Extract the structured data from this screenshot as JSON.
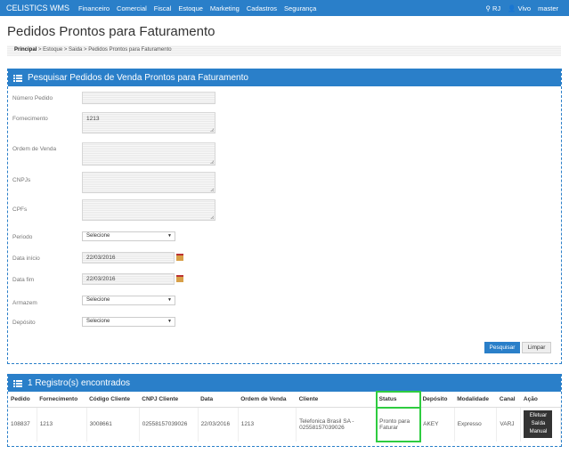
{
  "navbar": {
    "brand": "CELISTICS WMS",
    "menu": [
      "Financeiro",
      "Comercial",
      "Fiscal",
      "Estoque",
      "Marketing",
      "Cadastros",
      "Segurança"
    ],
    "location": "RJ",
    "user_name": "Vivo",
    "user_role": "master"
  },
  "page": {
    "title": "Pedidos Prontos para Faturamento",
    "breadcrumb_root": "Principal",
    "breadcrumb_rest": " > Estoque > Saida > Pedidos Prontos para Faturamento"
  },
  "search_panel": {
    "title": "Pesquisar Pedidos de Venda Prontos para Faturamento",
    "fields": {
      "numero_pedido": {
        "label": "Número Pedido",
        "value": ""
      },
      "fornecimento": {
        "label": "Fornecimento",
        "value": "1213"
      },
      "ordem_venda": {
        "label": "Ordem de Venda",
        "value": ""
      },
      "cnpjs": {
        "label": "CNPJs",
        "value": ""
      },
      "cpfs": {
        "label": "CPFs",
        "value": ""
      },
      "periodo": {
        "label": "Periodo",
        "value": "Selecione"
      },
      "data_inicio": {
        "label": "Data início",
        "value": "22/03/2016"
      },
      "data_fim": {
        "label": "Data fim",
        "value": "22/03/2016"
      },
      "armazem": {
        "label": "Armazem",
        "value": "Selecione"
      },
      "deposito": {
        "label": "Depósito",
        "value": "Selecione"
      }
    },
    "search_button": "Pesquisar",
    "clear_button": "Limpar"
  },
  "results_panel": {
    "title": "1 Registro(s) encontrados",
    "columns": [
      "Pedido",
      "Fornecimento",
      "Código Cliente",
      "CNPJ Cliente",
      "Data",
      "Ordem de Venda",
      "Cliente",
      "Status",
      "Depósito",
      "Modalidade",
      "Canal",
      "Ação"
    ],
    "rows": [
      {
        "pedido": "108837",
        "fornecimento": "1213",
        "codigo_cliente": "3008661",
        "cnpj_cliente": "02558157039026",
        "data": "22/03/2016",
        "ordem_venda": "1213",
        "cliente": "Telefonica Brasil SA - 02558157039026",
        "status": "Pronto para Faturar",
        "deposito": "AKEY",
        "modalidade": "Expresso",
        "canal": "VARJ",
        "acao": "Efetuar Saída Manual"
      }
    ]
  },
  "colors": {
    "primary": "#2a7fc9",
    "highlight": "#2ecc40"
  }
}
